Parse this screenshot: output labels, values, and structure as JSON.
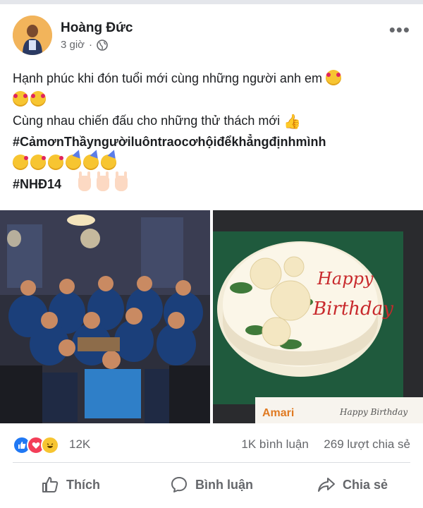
{
  "post": {
    "author": "Hoàng Đức",
    "time": "3 giờ",
    "separator": "·",
    "lines": [
      "Hạnh phúc khi đón tuổi mới cùng những người anh em",
      "Cùng nhau chiến đấu cho những thử thách mới",
      "#CảmơnThầyngườiluôntraocơhộiđểkhẳngđịnhmình",
      "#NHĐ14"
    ],
    "icons": {
      "avatar": "avatar-icon",
      "privacy": "globe-icon",
      "menu": "more-options-icon"
    },
    "photos": {
      "left_caption": "",
      "cake_text_1": "Happy",
      "cake_text_2": "Birthday",
      "cake_brand": "Amari",
      "cake_card": "Happy Birthday"
    }
  },
  "stats": {
    "reactions_count": "12K",
    "comments": "1K bình luận",
    "shares": "269 lượt chia sẻ"
  },
  "actions": {
    "like": "Thích",
    "comment": "Bình luận",
    "share": "Chia sẻ"
  },
  "colors": {
    "like_blue": "#2078f4",
    "love_red": "#f33e58",
    "haha_yellow": "#f7c531",
    "text_gray": "#65676b"
  }
}
